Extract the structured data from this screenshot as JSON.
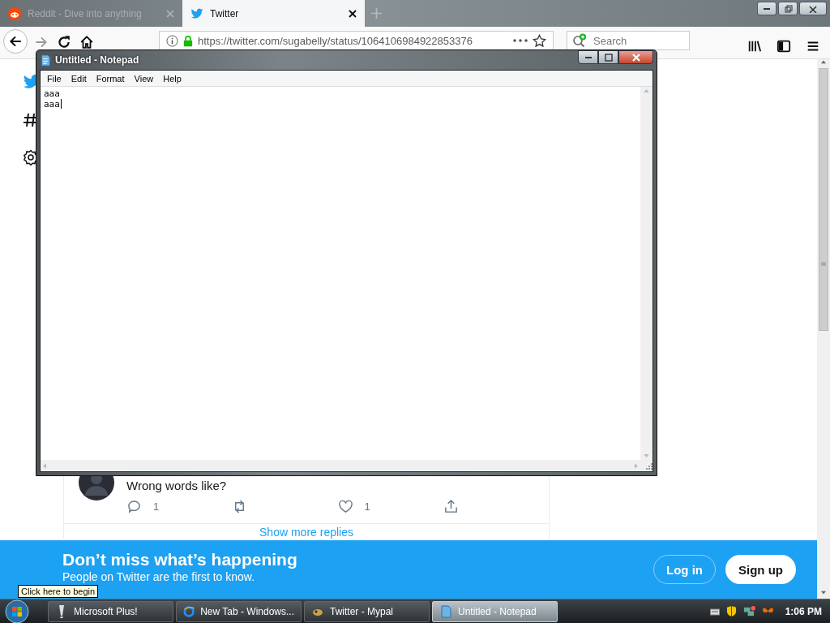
{
  "browser": {
    "tabs": [
      {
        "title": "Reddit - Dive into anything",
        "selected": false
      },
      {
        "title": "Twitter",
        "selected": true
      }
    ],
    "url": "https://twitter.com/sugabelly/status/1064106984922853376",
    "search": {
      "placeholder": "Search"
    }
  },
  "tweet": {
    "text": "Wrong words like?",
    "actions": [
      {
        "kind": "reply",
        "count": "1"
      },
      {
        "kind": "retweet"
      },
      {
        "kind": "like",
        "count": "1"
      },
      {
        "kind": "share"
      }
    ]
  },
  "show_more": "Show more replies",
  "banner": {
    "title": "Don’t miss what’s happening",
    "subtitle": "People on Twitter are the first to know.",
    "buttons": [
      {
        "label": "Log in",
        "kind": "outline"
      },
      {
        "label": "Sign up",
        "kind": "filled"
      }
    ]
  },
  "notepad": {
    "title": "Untitled - Notepad",
    "menu": [
      "File",
      "Edit",
      "Format",
      "View",
      "Help"
    ],
    "lines": [
      "aaa",
      "aaa"
    ]
  },
  "tooltip": "Click here to begin",
  "taskbar": {
    "items": [
      {
        "label": "Microsoft Plus!",
        "selected": false
      },
      {
        "label": "New Tab - Windows...",
        "selected": false
      },
      {
        "label": "Twitter - Mypal",
        "selected": false
      },
      {
        "label": "Untitled - Notepad",
        "selected": true
      }
    ],
    "clock": "1:06 PM"
  }
}
